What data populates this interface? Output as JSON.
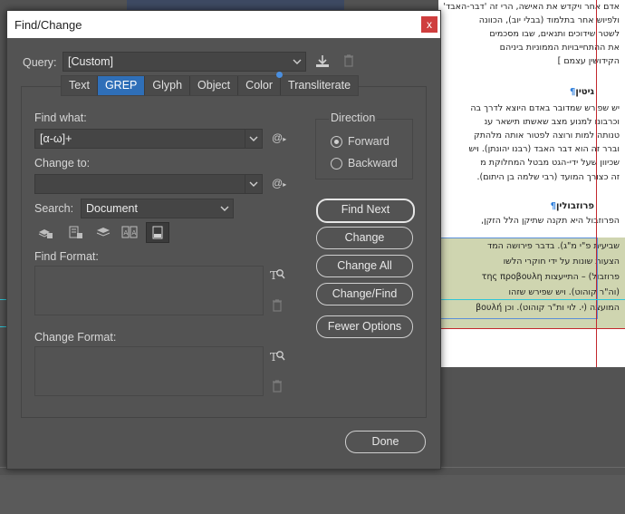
{
  "dialog": {
    "title": "Find/Change",
    "close_label": "x"
  },
  "query": {
    "label": "Query:",
    "value": "[Custom]"
  },
  "tabs": [
    {
      "label": "Text",
      "active": false
    },
    {
      "label": "GREP",
      "active": true
    },
    {
      "label": "Glyph",
      "active": false
    },
    {
      "label": "Object",
      "active": false
    },
    {
      "label": "Color",
      "active": false
    },
    {
      "label": "Transliterate",
      "active": false
    }
  ],
  "find_what": {
    "label": "Find what:",
    "value": "[α-ω]+",
    "special_label": "@"
  },
  "change_to": {
    "label": "Change to:",
    "value": "",
    "special_label": "@"
  },
  "search": {
    "label": "Search:",
    "value": "Document"
  },
  "find_format": {
    "label": "Find Format:"
  },
  "change_format": {
    "label": "Change Format:"
  },
  "direction": {
    "label": "Direction",
    "options": [
      {
        "label": "Forward",
        "selected": true
      },
      {
        "label": "Backward",
        "selected": false
      }
    ]
  },
  "buttons": {
    "find_next": "Find Next",
    "change": "Change",
    "change_all": "Change All",
    "change_find": "Change/Find",
    "fewer_options": "Fewer Options",
    "done": "Done"
  },
  "colors": {
    "accent": "#2f6fb8",
    "close": "#cf3e3e",
    "highlight": "#cfd5b0"
  },
  "document": {
    "lines_top": [
      "אדם אחר ויקדש את האישה, הרי זה 'דבר-האבד'",
      "ולפיוש אחר בתלמוד (בבלי יוב), הכוונה",
      "לשטר שידוכים ותנאים, שבו מסכמים",
      "את ההתחייבויות הממוניות ביניהם",
      "הקידושין עצמם ]"
    ],
    "head1": "גיטין",
    "lines_mid": [
      "יש שפירש שמדובר באדם היוצא לדרך בה",
      "וכרבונו למנוע מצב שאשתו תישאר ענ",
      "טנותה למות ורוצה לפטור אותה מלהתק",
      "וברר זה הוא דבר האבד (רבנו יהונתן). ויש",
      "שכיוון שעל ידי-הגט מבטל המחלוקת מ",
      "זה כצורך המועד (רבי שלמה בן היתום)."
    ],
    "head2": "פרוזבולין",
    "lines_low": [
      "הפרוזבול היא תקנה שתיקן הלל הזקן,"
    ],
    "lines_hl": [
      "שביעית פ\"י מ\"ג). בדבר פירושה המד",
      "הצעות שונות על ידי חוקרי הלשו",
      "פרוזבול) – התייעצות της προβουλη",
      "(וה\"ר קוהוט). ויש שפירש שזהו",
      "המועצה (י. לוי ות\"ר קוהוט). וכן βουλή"
    ]
  }
}
